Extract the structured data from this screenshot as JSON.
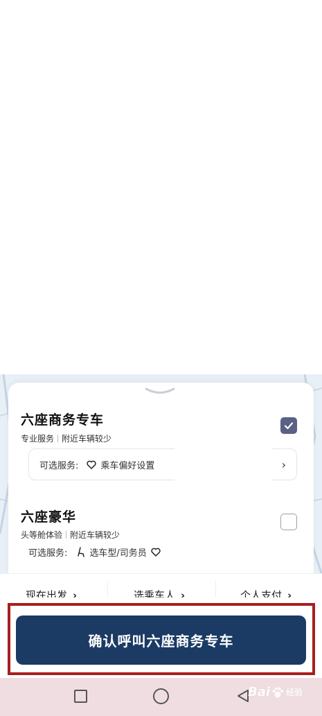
{
  "cars": [
    {
      "title": "六座商务专车",
      "tags": [
        "专业服务",
        "附近车辆较少"
      ],
      "services_label": "可选服务:",
      "services": [
        "乘车偏好设置"
      ],
      "selected": true
    },
    {
      "title": "六座豪华",
      "tags": [
        "头等舱体验",
        "附近车辆较少"
      ],
      "services_label": "可选服务:",
      "services": [
        "选车型/司务员"
      ],
      "selected": false
    }
  ],
  "options": {
    "depart": "现在出发",
    "passenger": "选乘车人",
    "payment": "个人支付"
  },
  "confirm_label": "确认呼叫六座商务专车",
  "watermark": {
    "text": "Bai",
    "suffix": "经验"
  },
  "colors": {
    "primary": "#1b3a64",
    "checkbox": "#5a6185",
    "highlight": "#a81e1e",
    "navbar": "#f0dde2"
  }
}
